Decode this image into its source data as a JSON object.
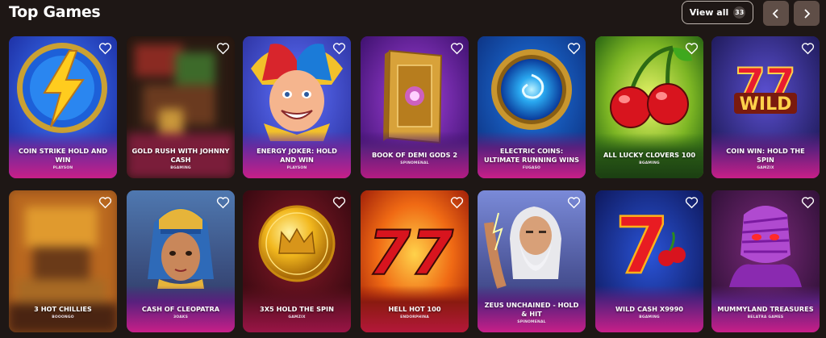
{
  "section": {
    "title": "Top Games",
    "view_all_label": "View all",
    "count": "33"
  },
  "icons": {
    "prev": "chevron-left-icon",
    "next": "chevron-right-icon",
    "favorite": "heart-outline-icon"
  },
  "colors": {
    "page_bg": "#1e1715",
    "nav_button_bg": "#5f4e47",
    "badge_bg": "#4b4340",
    "card_caption_gradient_top": "#6a2a8e",
    "card_caption_gradient_bottom": "#d81b7a"
  },
  "games": [
    {
      "name": "COIN STRIKE HOLD AND WIN",
      "provider": "PLAYSON",
      "icon": "lightning-coin-icon"
    },
    {
      "name": "GOLD RUSH WITH JOHNNY CASH",
      "provider": "BGAMING",
      "icon": "blurred-thumbnail"
    },
    {
      "name": "ENERGY JOKER: HOLD AND WIN",
      "provider": "PLAYSON",
      "icon": "jester-face-icon"
    },
    {
      "name": "BOOK OF DEMI GODS 2",
      "provider": "SPINOMENAL",
      "icon": "golden-book-icon"
    },
    {
      "name": "ELECTRIC COINS: ULTIMATE RUNNING WINS",
      "provider": "FUGASO",
      "icon": "electric-coin-icon"
    },
    {
      "name": "ALL LUCKY CLOVERS 100",
      "provider": "BGAMING",
      "icon": "cherries-icon"
    },
    {
      "name": "COIN WIN: HOLD THE SPIN",
      "provider": "GAMZIX",
      "icon": "seven-seven-wild-icon"
    },
    {
      "name": "3 HOT CHILLIES",
      "provider": "BOOONGO",
      "icon": "blurred-thumbnail"
    },
    {
      "name": "CASH OF CLEOPATRA",
      "provider": "3OAKS",
      "icon": "cleopatra-icon"
    },
    {
      "name": "3X5 HOLD THE SPIN",
      "provider": "GAMZIX",
      "icon": "crown-coin-icon"
    },
    {
      "name": "HELL HOT 100",
      "provider": "ENDORPHINA",
      "icon": "fiery-sevens-icon"
    },
    {
      "name": "ZEUS UNCHAINED - HOLD & HIT",
      "provider": "SPINOMENAL",
      "icon": "zeus-icon"
    },
    {
      "name": "WILD CASH X9990",
      "provider": "BGAMING",
      "icon": "seven-cherries-icon"
    },
    {
      "name": "MUMMYLAND TREASURES",
      "provider": "BELATRA GAMES",
      "icon": "mummy-icon"
    }
  ]
}
